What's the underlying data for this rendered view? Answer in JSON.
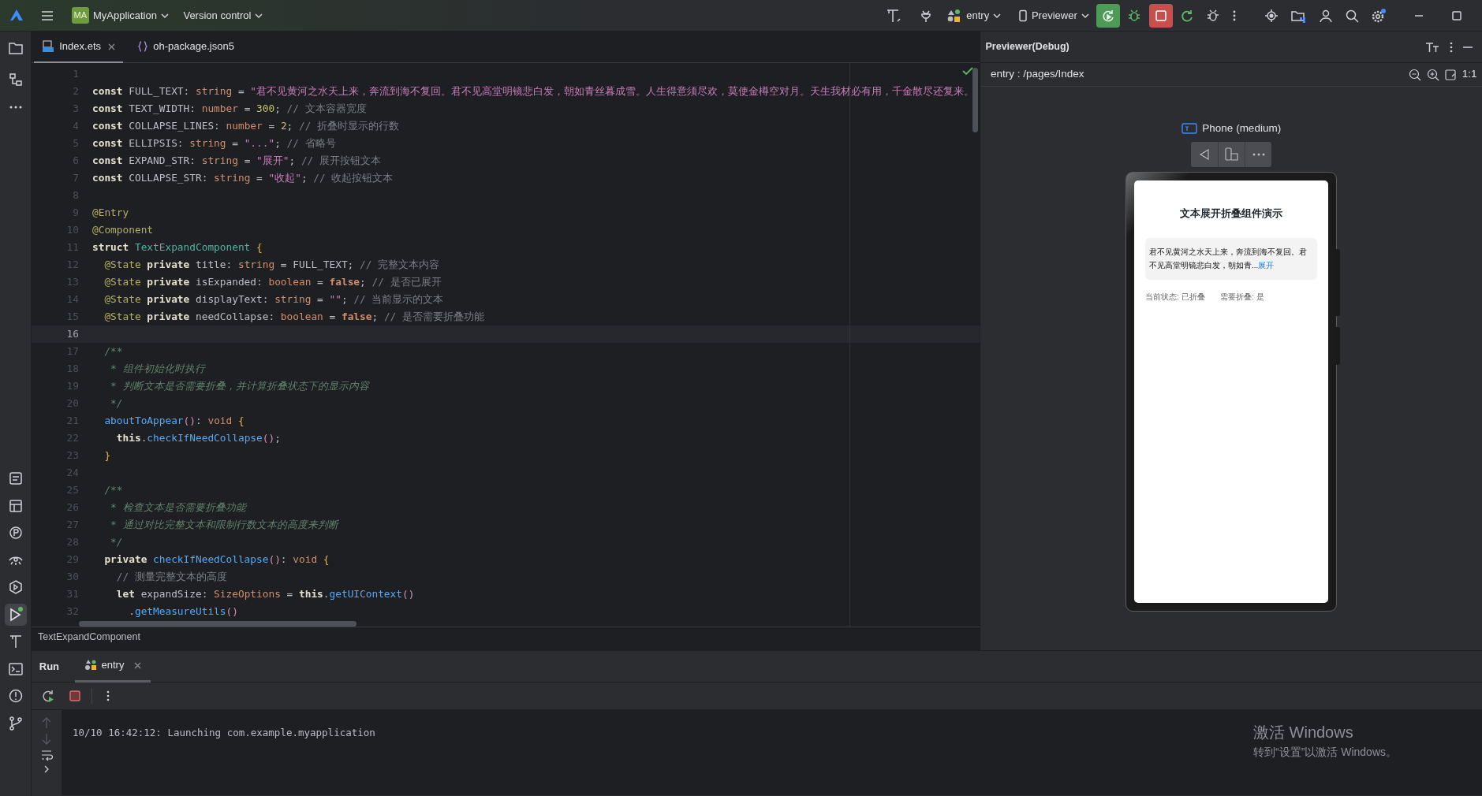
{
  "top_bar": {
    "project_initials": "MA",
    "project_name": "MyApplication",
    "vcs_menu": "Version control",
    "run_config": "entry",
    "device_menu": "Previewer"
  },
  "editor_tabs": [
    {
      "label": "Index.ets",
      "kind": "ets",
      "selected": true
    },
    {
      "label": "oh-package.json5",
      "kind": "json",
      "selected": false
    }
  ],
  "code_lines": [
    {
      "number": "1",
      "current": false
    },
    {
      "number": "2",
      "current": false,
      "tokens": [
        {
          "kind": "kw",
          "text": "const"
        },
        {
          "kind": "plain",
          "text": " FULL_TEXT: "
        },
        {
          "kind": "type",
          "text": "string"
        },
        {
          "kind": "plain",
          "text": " = "
        },
        {
          "kind": "str",
          "text": "\"君不见黄河之水天上来，奔流到海不复回。君不见高堂明镜悲白发，朝如青丝暮成雪。人生得意须尽欢，莫使金樽空对月。天生我材必有用，千金散尽还复来。"
        }
      ]
    },
    {
      "number": "3",
      "current": false,
      "tokens": [
        {
          "kind": "kw",
          "text": "const"
        },
        {
          "kind": "plain",
          "text": " TEXT_WIDTH: "
        },
        {
          "kind": "type",
          "text": "number"
        },
        {
          "kind": "plain",
          "text": " = "
        },
        {
          "kind": "num",
          "text": "300"
        },
        {
          "kind": "plain",
          "text": "; "
        },
        {
          "kind": "cm",
          "text": "// 文本容器宽度"
        }
      ]
    },
    {
      "number": "4",
      "current": false,
      "tokens": [
        {
          "kind": "kw",
          "text": "const"
        },
        {
          "kind": "plain",
          "text": " COLLAPSE_LINES: "
        },
        {
          "kind": "type",
          "text": "number"
        },
        {
          "kind": "plain",
          "text": " = "
        },
        {
          "kind": "num",
          "text": "2"
        },
        {
          "kind": "plain",
          "text": "; "
        },
        {
          "kind": "cm",
          "text": "// 折叠时显示的行数"
        }
      ]
    },
    {
      "number": "5",
      "current": false,
      "tokens": [
        {
          "kind": "kw",
          "text": "const"
        },
        {
          "kind": "plain",
          "text": " ELLIPSIS: "
        },
        {
          "kind": "type",
          "text": "string"
        },
        {
          "kind": "plain",
          "text": " = "
        },
        {
          "kind": "str",
          "text": "\"...\""
        },
        {
          "kind": "plain",
          "text": "; "
        },
        {
          "kind": "cm",
          "text": "// 省略号"
        }
      ]
    },
    {
      "number": "6",
      "current": false,
      "tokens": [
        {
          "kind": "kw",
          "text": "const"
        },
        {
          "kind": "plain",
          "text": " EXPAND_STR: "
        },
        {
          "kind": "type",
          "text": "string"
        },
        {
          "kind": "plain",
          "text": " = "
        },
        {
          "kind": "str",
          "text": "\"展开\""
        },
        {
          "kind": "plain",
          "text": "; "
        },
        {
          "kind": "cm",
          "text": "// 展开按钮文本"
        }
      ]
    },
    {
      "number": "7",
      "current": false,
      "tokens": [
        {
          "kind": "kw",
          "text": "const"
        },
        {
          "kind": "plain",
          "text": " COLLAPSE_STR: "
        },
        {
          "kind": "type",
          "text": "string"
        },
        {
          "kind": "plain",
          "text": " = "
        },
        {
          "kind": "str",
          "text": "\"收起\""
        },
        {
          "kind": "plain",
          "text": "; "
        },
        {
          "kind": "cm",
          "text": "// 收起按钮文本"
        }
      ]
    },
    {
      "number": "8",
      "current": false
    },
    {
      "number": "9",
      "current": false,
      "tokens": [
        {
          "kind": "deco",
          "text": "@Entry"
        }
      ]
    },
    {
      "number": "10",
      "current": false,
      "tokens": [
        {
          "kind": "deco",
          "text": "@Component"
        }
      ]
    },
    {
      "number": "11",
      "current": false,
      "tokens": [
        {
          "kind": "kw",
          "text": "struct "
        },
        {
          "kind": "cls",
          "text": "TextExpandComponent "
        },
        {
          "kind": "brace",
          "text": "{"
        }
      ]
    },
    {
      "number": "12",
      "current": false,
      "tokens": [
        {
          "kind": "deco",
          "text": "  @State "
        },
        {
          "kind": "kw",
          "text": "private"
        },
        {
          "kind": "plain",
          "text": " title: "
        },
        {
          "kind": "type",
          "text": "string"
        },
        {
          "kind": "plain",
          "text": " = FULL_TEXT; "
        },
        {
          "kind": "cm",
          "text": "// 完整文本内容"
        }
      ]
    },
    {
      "number": "13",
      "current": false,
      "tokens": [
        {
          "kind": "deco",
          "text": "  @State "
        },
        {
          "kind": "kw",
          "text": "private"
        },
        {
          "kind": "plain",
          "text": " isExpanded: "
        },
        {
          "kind": "type",
          "text": "boolean"
        },
        {
          "kind": "plain",
          "text": " = "
        },
        {
          "kind": "kwo",
          "text": "false"
        },
        {
          "kind": "plain",
          "text": "; "
        },
        {
          "kind": "cm",
          "text": "// 是否已展开"
        }
      ]
    },
    {
      "number": "14",
      "current": false,
      "tokens": [
        {
          "kind": "deco",
          "text": "  @State "
        },
        {
          "kind": "kw",
          "text": "private"
        },
        {
          "kind": "plain",
          "text": " displayText: "
        },
        {
          "kind": "type",
          "text": "string"
        },
        {
          "kind": "plain",
          "text": " = "
        },
        {
          "kind": "str",
          "text": "\"\""
        },
        {
          "kind": "plain",
          "text": "; "
        },
        {
          "kind": "cm",
          "text": "// 当前显示的文本"
        }
      ]
    },
    {
      "number": "15",
      "current": false,
      "tokens": [
        {
          "kind": "deco",
          "text": "  @State "
        },
        {
          "kind": "kw",
          "text": "private"
        },
        {
          "kind": "plain",
          "text": " needCollapse: "
        },
        {
          "kind": "type",
          "text": "boolean"
        },
        {
          "kind": "plain",
          "text": " = "
        },
        {
          "kind": "kwo",
          "text": "false"
        },
        {
          "kind": "plain",
          "text": "; "
        },
        {
          "kind": "cm",
          "text": "// 是否需要折叠功能"
        }
      ]
    },
    {
      "number": "16",
      "current": true
    },
    {
      "number": "17",
      "current": false,
      "tokens": [
        {
          "kind": "doc",
          "text": "  /**"
        }
      ]
    },
    {
      "number": "18",
      "current": false,
      "tokens": [
        {
          "kind": "doc",
          "text": "   * 组件初始化时执行"
        }
      ]
    },
    {
      "number": "19",
      "current": false,
      "tokens": [
        {
          "kind": "doc",
          "text": "   * 判断文本是否需要折叠，并计算折叠状态下的显示内容"
        }
      ]
    },
    {
      "number": "20",
      "current": false,
      "tokens": [
        {
          "kind": "doc",
          "text": "   */"
        }
      ]
    },
    {
      "number": "21",
      "current": false,
      "tokens": [
        {
          "kind": "fn",
          "text": "  aboutToAppear"
        },
        {
          "kind": "paren",
          "text": "()"
        },
        {
          "kind": "plain",
          "text": ": "
        },
        {
          "kind": "type",
          "text": "void "
        },
        {
          "kind": "brace",
          "text": "{"
        }
      ]
    },
    {
      "number": "22",
      "current": false,
      "tokens": [
        {
          "kind": "kw",
          "text": "    this"
        },
        {
          "kind": "plain",
          "text": "."
        },
        {
          "kind": "fn",
          "text": "checkIfNeedCollapse"
        },
        {
          "kind": "paren",
          "text": "()"
        },
        {
          "kind": "plain",
          "text": ";"
        }
      ]
    },
    {
      "number": "23",
      "current": false,
      "tokens": [
        {
          "kind": "brace",
          "text": "  }"
        }
      ]
    },
    {
      "number": "24",
      "current": false
    },
    {
      "number": "25",
      "current": false,
      "tokens": [
        {
          "kind": "doc",
          "text": "  /**"
        }
      ]
    },
    {
      "number": "26",
      "current": false,
      "tokens": [
        {
          "kind": "doc",
          "text": "   * 检查文本是否需要折叠功能"
        }
      ]
    },
    {
      "number": "27",
      "current": false,
      "tokens": [
        {
          "kind": "doc",
          "text": "   * 通过对比完整文本和限制行数文本的高度来判断"
        }
      ]
    },
    {
      "number": "28",
      "current": false,
      "tokens": [
        {
          "kind": "doc",
          "text": "   */"
        }
      ]
    },
    {
      "number": "29",
      "current": false,
      "tokens": [
        {
          "kind": "kw",
          "text": "  private "
        },
        {
          "kind": "fn",
          "text": "checkIfNeedCollapse"
        },
        {
          "kind": "paren",
          "text": "()"
        },
        {
          "kind": "plain",
          "text": ": "
        },
        {
          "kind": "type",
          "text": "void "
        },
        {
          "kind": "brace",
          "text": "{"
        }
      ]
    },
    {
      "number": "30",
      "current": false,
      "tokens": [
        {
          "kind": "cm",
          "text": "    // 测量完整文本的高度"
        }
      ]
    },
    {
      "number": "31",
      "current": false,
      "tokens": [
        {
          "kind": "kw",
          "text": "    let"
        },
        {
          "kind": "plain",
          "text": " expandSize: "
        },
        {
          "kind": "type",
          "text": "SizeOptions"
        },
        {
          "kind": "plain",
          "text": " = "
        },
        {
          "kind": "kw",
          "text": "this"
        },
        {
          "kind": "plain",
          "text": "."
        },
        {
          "kind": "fn",
          "text": "getUIContext"
        },
        {
          "kind": "paren",
          "text": "()"
        }
      ]
    },
    {
      "number": "32",
      "current": false,
      "tokens": [
        {
          "kind": "plain",
          "text": "      ."
        },
        {
          "kind": "fn",
          "text": "getMeasureUtils"
        },
        {
          "kind": "paren",
          "text": "()"
        }
      ]
    }
  ],
  "breadcrumb": "TextExpandComponent",
  "previewer": {
    "title": "Previewer(Debug)",
    "path": "entry : /pages/Index",
    "zoom_reset": "1:1",
    "device": "Phone (medium)",
    "app": {
      "title": "文本展开折叠组件演示",
      "text": "君不见黄河之水天上来，奔流到海不复回。君不见高堂明镜悲白发，朝如青...",
      "toggle": "展开",
      "status": "当前状态: 已折叠",
      "need_collapse": "需要折叠: 是"
    }
  },
  "run_panel": {
    "title": "Run",
    "tabs": [
      {
        "label": "entry",
        "selected": true
      }
    ],
    "console": [
      "10/10 16:42:12: Launching com.example.myapplication"
    ]
  },
  "os_notice": {
    "title": "激活 Windows",
    "text": "转到“设置”以激活 Windows。"
  }
}
